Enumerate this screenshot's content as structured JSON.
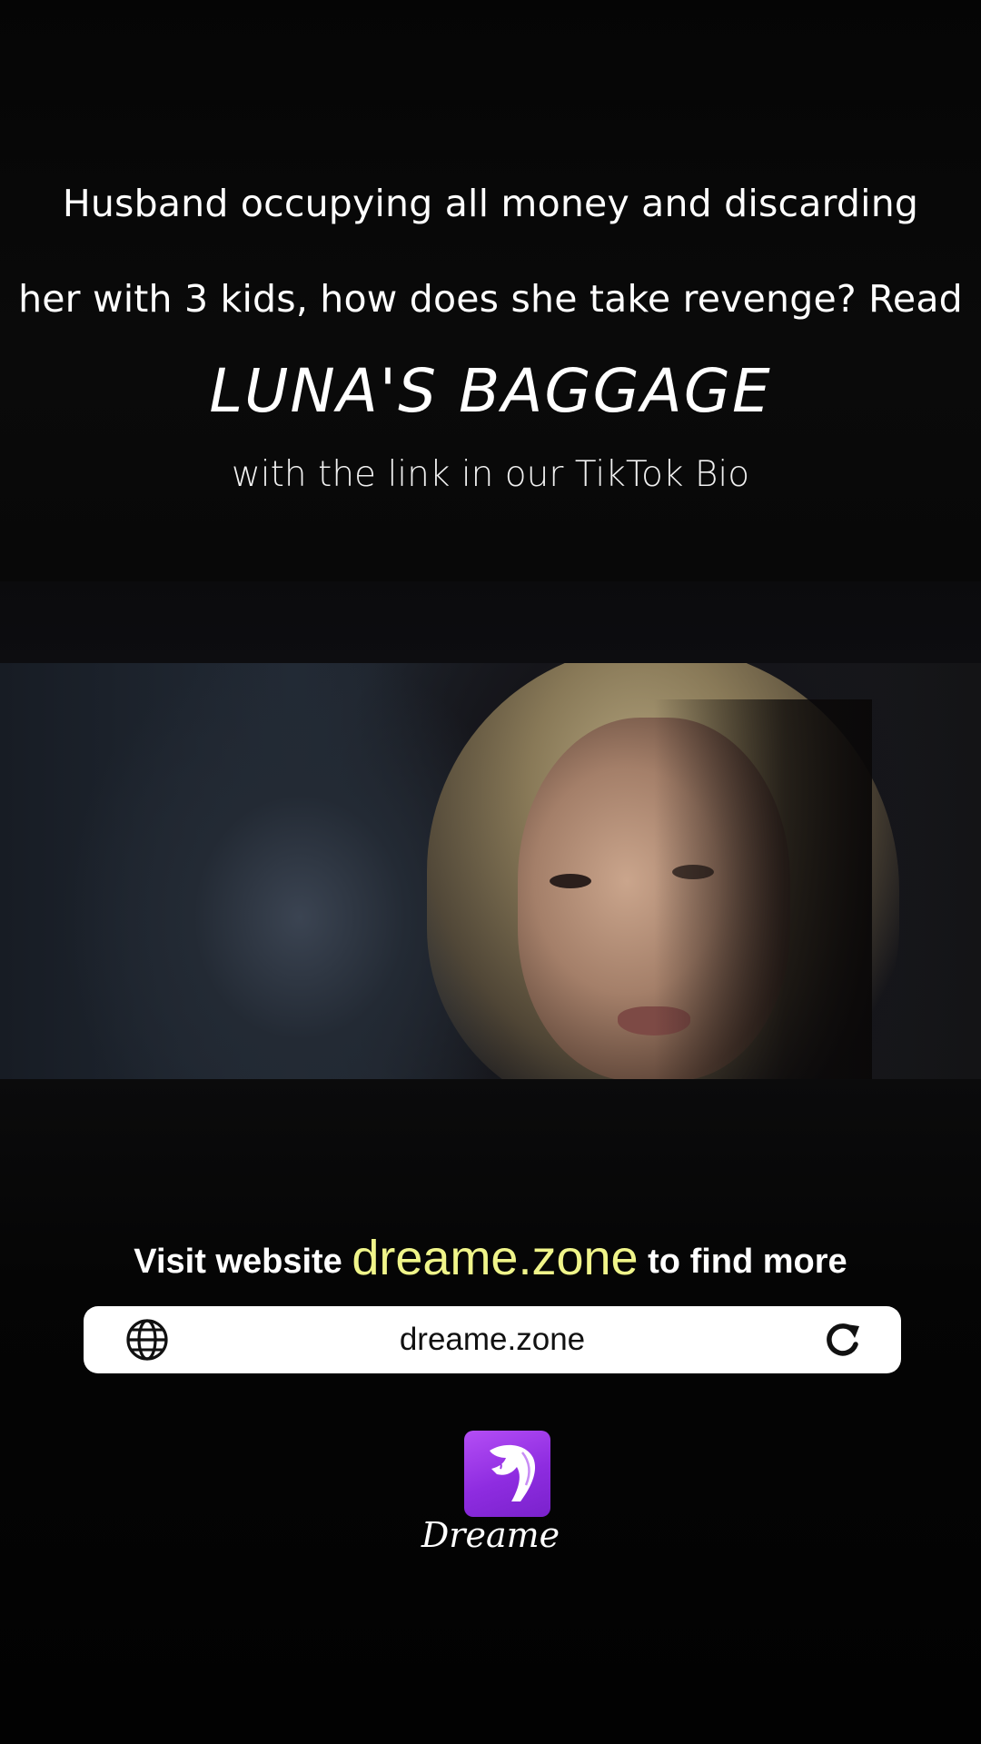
{
  "caption": {
    "line1": "Husband occupying all money and discarding",
    "line2": "her with 3 kids, how does she take revenge? Read",
    "title": "LUNA'S BAGGAGE",
    "subline": "with the link in our TikTok Bio"
  },
  "banner": {
    "visit_prefix": "Visit website",
    "visit_site": "dreame.zone",
    "visit_suffix": "to find more",
    "url": "dreame.zone",
    "globe_icon": "globe-icon",
    "reload_icon": "reload-icon",
    "accent_color": "#f0f58a"
  },
  "app": {
    "name": "Dreame",
    "icon": "dreame-logo-icon",
    "icon_color": "#9b35e8"
  }
}
